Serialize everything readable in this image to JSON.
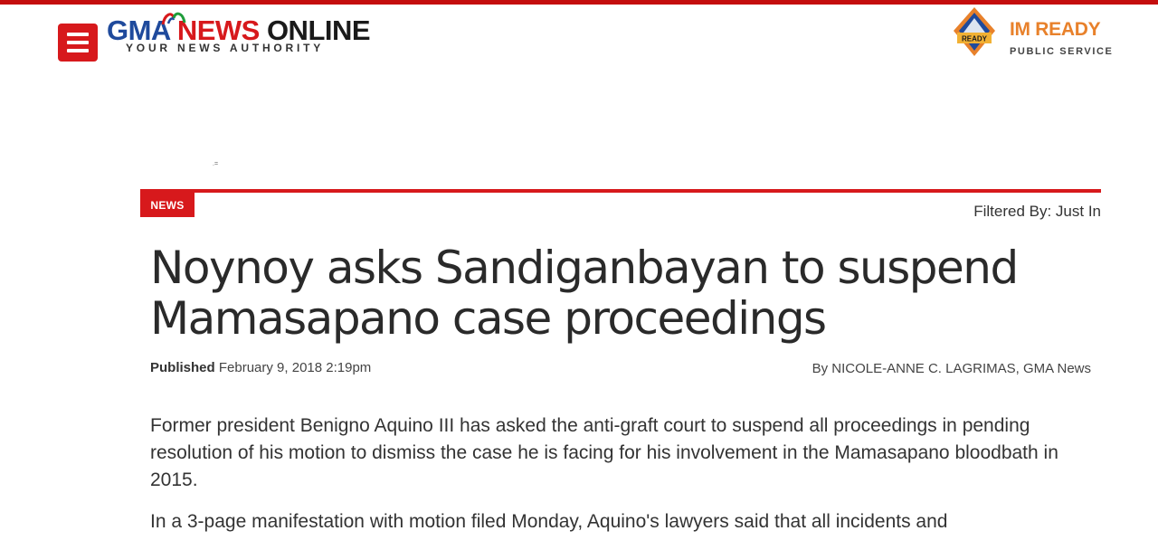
{
  "header": {
    "brand": {
      "gma": "GMA",
      "news": "NEWS",
      "online": "ONLINE",
      "tagline": "YOUR NEWS AUTHORITY"
    },
    "imready": {
      "title": "IM READY",
      "subtitle": "PUBLIC SERVICE",
      "badge": "READY"
    }
  },
  "ad_marker": ".=",
  "section": {
    "tag": "NEWS",
    "filter": "Filtered By: Just In"
  },
  "article": {
    "title": "Noynoy asks Sandiganbayan to suspend Mamasapano case proceedings",
    "published_label": "Published",
    "published_date": "February 9, 2018 2:19pm",
    "byline": "By NICOLE-ANNE C. LAGRIMAS, GMA News",
    "paragraphs": [
      "Former president Benigno Aquino III has asked the anti-graft court to suspend all proceedings in pending resolution of his motion to dismiss the case he is facing for his involvement in the Mamasapano bloodbath in 2015.",
      "In a 3-page manifestation with motion filed Monday, Aquino's lawyers said that all incidents and"
    ]
  },
  "colors": {
    "brand_red": "#d7191c",
    "brand_blue": "#1f4a9c",
    "imready_orange": "#e8812b"
  }
}
